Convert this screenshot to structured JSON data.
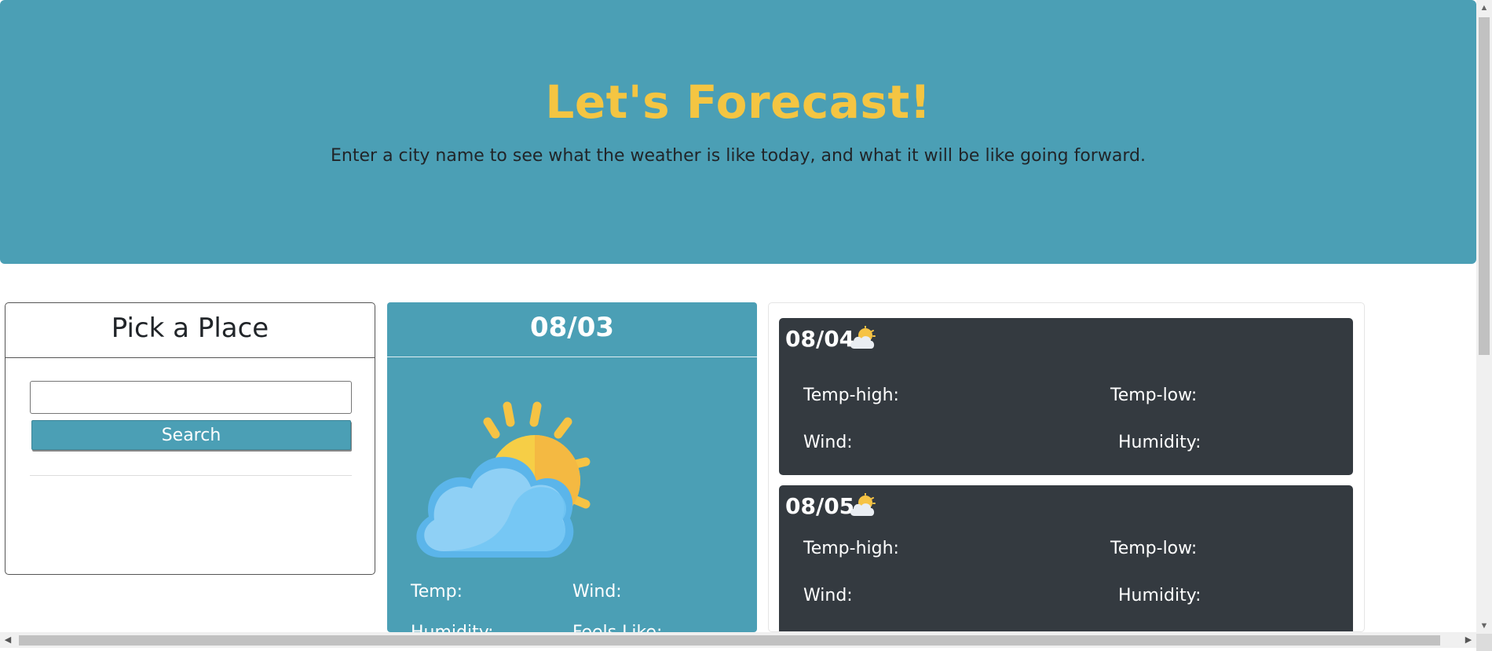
{
  "hero": {
    "title": "Let's Forecast!",
    "subtitle": "Enter a city name to see what the weather is like today, and what it will be like going forward."
  },
  "pick": {
    "title": "Pick a Place",
    "input_value": "",
    "search_label": "Search"
  },
  "today": {
    "date": "08/03",
    "icon": "partly-cloudy-icon",
    "temp_label": "Temp:",
    "wind_label": "Wind:",
    "humidity_label": "Humidity:",
    "feels_like_label": "Feels Like:"
  },
  "forecast": [
    {
      "date": "08/04",
      "icon": "partly-cloudy-icon",
      "temp_high_label": "Temp-high:",
      "temp_low_label": "Temp-low:",
      "wind_label": "Wind:",
      "humidity_label": "Humidity:"
    },
    {
      "date": "08/05",
      "icon": "partly-cloudy-icon",
      "temp_high_label": "Temp-high:",
      "temp_low_label": "Temp-low:",
      "wind_label": "Wind:",
      "humidity_label": "Humidity:"
    }
  ],
  "colors": {
    "accent": "#4b9fb5",
    "title": "#f4c542",
    "card_dark": "#343a40"
  }
}
